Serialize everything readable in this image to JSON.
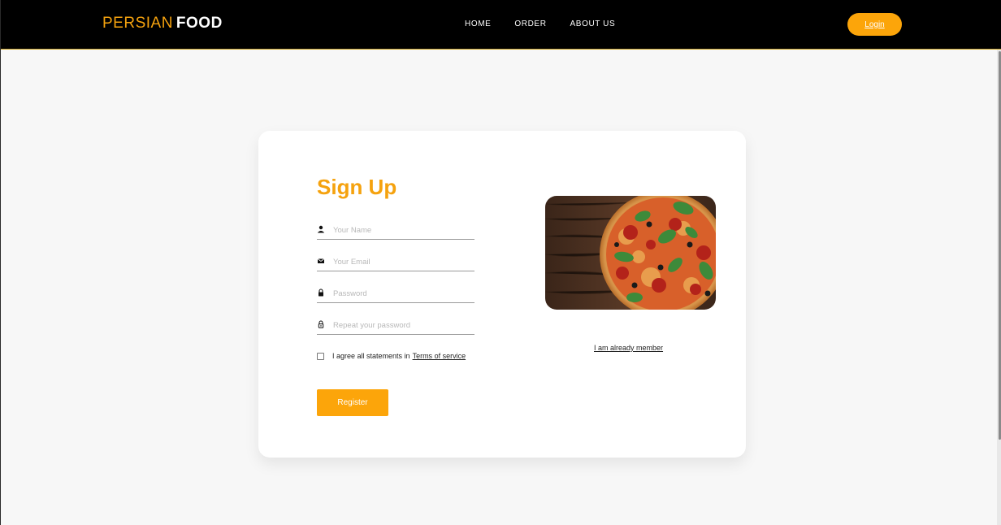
{
  "brand": {
    "part1": "PERSIAN",
    "part2": "FOOD"
  },
  "nav": {
    "items": [
      "HOME",
      "ORDER",
      "ABOUT US"
    ]
  },
  "header": {
    "login_label": "Login"
  },
  "form": {
    "title": "Sign Up",
    "name_placeholder": "Your Name",
    "email_placeholder": "Your Email",
    "password_placeholder": "Password",
    "repeat_placeholder": "Repeat your password",
    "agree_text": "I agree all statements in",
    "terms_label": "Terms of service",
    "register_label": "Register"
  },
  "side": {
    "member_link": "I am already member"
  },
  "colors": {
    "accent": "#fca50a",
    "brand": "#f5a20e",
    "header_bg": "#000000"
  },
  "icons": [
    "user-icon",
    "email-icon",
    "lock-icon",
    "lock-outline-icon",
    "checkbox-icon"
  ]
}
